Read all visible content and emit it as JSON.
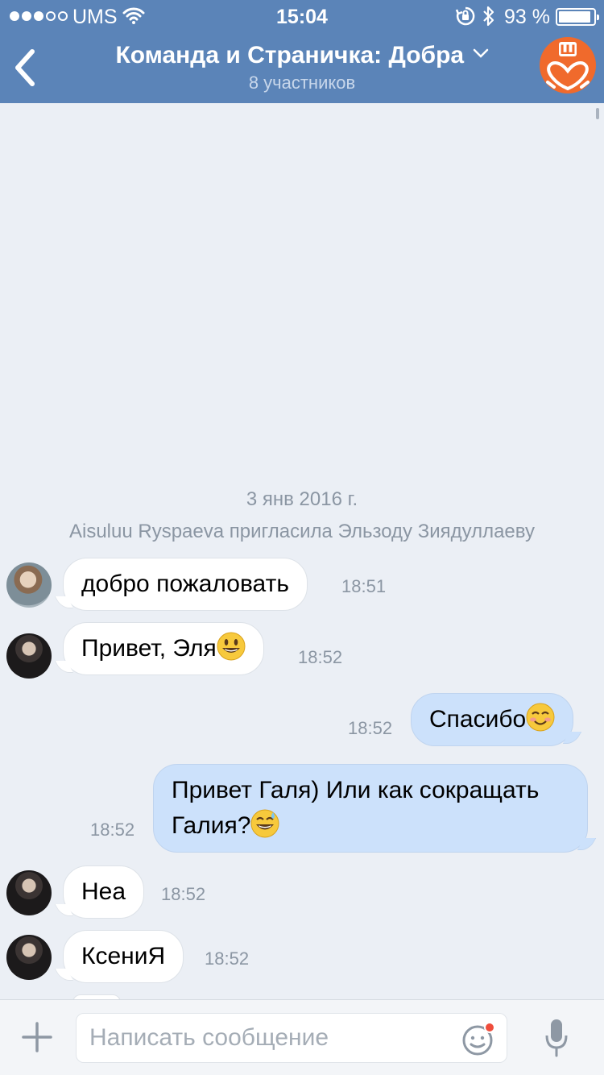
{
  "status_bar": {
    "carrier": "UMS",
    "time": "15:04",
    "battery_percent": "93 %",
    "battery_level": 0.93,
    "signal_bars_filled": 3,
    "signal_bars_total": 5
  },
  "nav": {
    "title": "Команда и Страничка: Добра",
    "subtitle": "8 участников",
    "group_avatar_letter": "Ш"
  },
  "chat": {
    "date_separator": "3 янв 2016 г.",
    "service_message": "Aisuluu Ryspaeva пригласила Эльзоду Зиядуллаеву",
    "messages": [
      {
        "direction": "in",
        "text": "добро пожаловать",
        "time": "18:51",
        "emoji": ""
      },
      {
        "direction": "in",
        "text": "Привет, Эля",
        "time": "18:52",
        "emoji": "smiling-face-icon"
      },
      {
        "direction": "out",
        "text": "Спасибо",
        "time": "18:52",
        "emoji": "blushing-face-icon"
      },
      {
        "direction": "out",
        "line1": "Привет Галя) Или как сокращать",
        "line2": "Галия?",
        "time": "18:52",
        "emoji": "sweat-smile-icon"
      },
      {
        "direction": "in",
        "text": "Неа",
        "time": "18:52",
        "emoji": ""
      },
      {
        "direction": "in",
        "text": "КсениЯ",
        "time": "18:52",
        "emoji": ""
      }
    ]
  },
  "composer": {
    "placeholder": "Написать сообщение"
  },
  "colors": {
    "header": "#5b84b8",
    "background": "#ebeff5",
    "outgoing_bubble": "#cce1fb",
    "incoming_bubble": "#ffffff",
    "meta_text": "#8b96a3",
    "group_avatar": "#f06a2c",
    "sticker_dot": "#ef4d3c"
  }
}
